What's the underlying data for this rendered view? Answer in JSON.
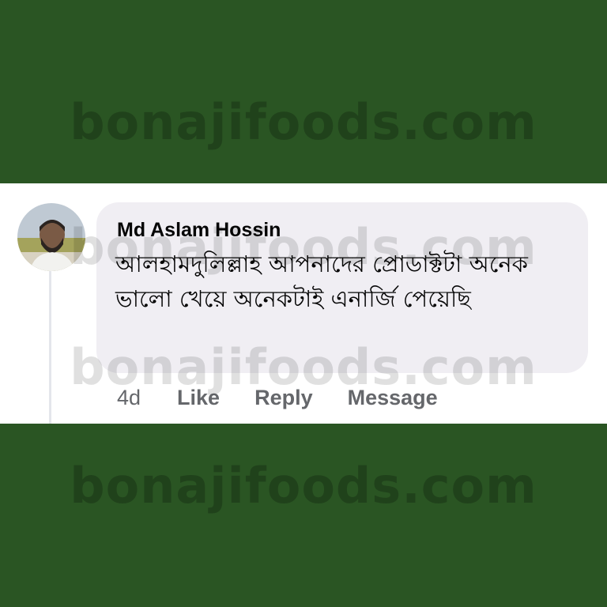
{
  "watermark": "bonajifoods.com",
  "comment": {
    "author": "Md Aslam Hossin",
    "text": "আলহামদুলিল্লাহ আপনাদের প্রোডাক্টটা অনেক ভালো খেয়ে অনেকটাই এনার্জি পেয়েছি",
    "time": "4d",
    "actions": {
      "like": "Like",
      "reply": "Reply",
      "message": "Message"
    }
  },
  "colors": {
    "brand_green": "#2a5523",
    "bubble": "#f0eef3",
    "meta_gray": "#65676b"
  }
}
